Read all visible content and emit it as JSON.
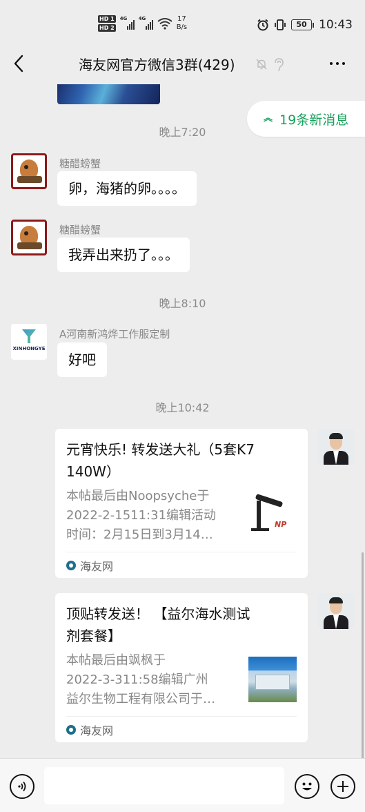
{
  "status_bar": {
    "hd_1": "HD 1",
    "hd_2": "HD 2",
    "signal_1": "4G",
    "signal_2": "4G",
    "speed_value": "17",
    "speed_unit": "B/s",
    "battery": "50",
    "time": "10:43"
  },
  "header": {
    "title": "海友网官方微信3群(429)"
  },
  "new_messages": {
    "label": "19条新消息"
  },
  "timestamps": [
    "晚上7:20",
    "晚上8:10",
    "晚上10:42"
  ],
  "messages": [
    {
      "sender": "糖醋螃蟹",
      "text": "卵，海猪的卵。。。。"
    },
    {
      "sender": "糖醋螃蟹",
      "text": "我弄出来扔了。。。"
    },
    {
      "sender": "A河南新鸿烨工作服定制",
      "text": "好吧",
      "avatar_text": "XINHONGYE"
    }
  ],
  "cards": [
    {
      "title_line1": "元宵快乐! 转发送大礼（5套K7",
      "title_line2": "140W）",
      "desc_line1": "本帖最后由Noopsyche于",
      "desc_line2": "2022-2-1511:31编辑活动",
      "desc_line3": "时间：2月15日到3月14…",
      "thumb_mark": "NP",
      "source": "海友网"
    },
    {
      "title_line1": "顶贴转发送！ 【益尔海水测试",
      "title_line2": "剂套餐】",
      "desc_line1": "本帖最后由飒枫于",
      "desc_line2": "2022-3-311:58编辑广州",
      "desc_line3": "益尔生物工程有限公司于…",
      "source": "海友网"
    }
  ],
  "colors": {
    "accent_green": "#19a05b",
    "background": "#ededed"
  },
  "icons": [
    "back-arrow-icon",
    "mute-bell-icon",
    "ear-icon",
    "more-icon",
    "voice-icon",
    "emoji-icon",
    "plus-icon"
  ]
}
